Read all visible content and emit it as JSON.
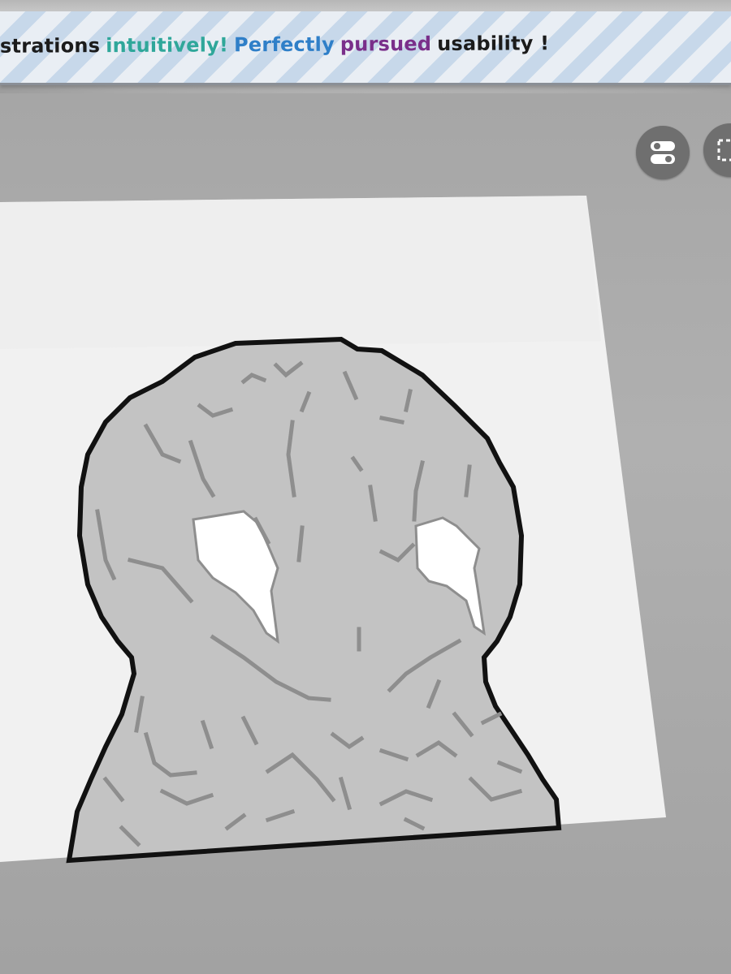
{
  "banner": {
    "segments": [
      {
        "text": "strations",
        "color": "#1b1b1b"
      },
      {
        "text": "intuitively!",
        "color": "#2fa79a"
      },
      {
        "text": "Perfectly",
        "color": "#2f7fc8"
      },
      {
        "text": "pursued",
        "color": "#7a2f8a"
      },
      {
        "text": "usability !",
        "color": "#1b1b1b"
      }
    ]
  },
  "toolbar": {
    "toggle_icon": "toggle-switch-icon",
    "select_icon": "selection-marquee-icon"
  },
  "canvas": {
    "background": "#f2f2f2",
    "fill": "#c3c3c3",
    "outline": "#111111",
    "detail": "#8e8e8e",
    "highlight": "#ffffff"
  },
  "colors": {
    "workspace": "#ababab",
    "banner_stripe_light": "#e9eef4",
    "banner_stripe_blue": "#c7d8ea",
    "button": "#6f6f6f"
  }
}
